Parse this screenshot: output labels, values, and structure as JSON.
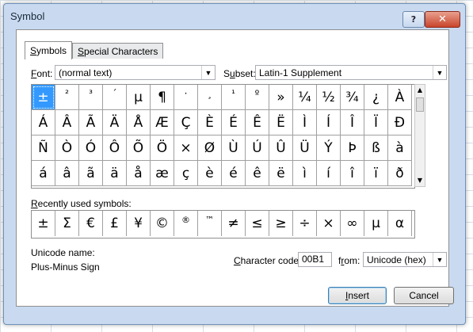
{
  "window": {
    "title": "Symbol",
    "help_label": "?",
    "close_label": "✕"
  },
  "tabs": {
    "symbols": "Symbols",
    "special": "Special Characters"
  },
  "font": {
    "label": "Font:",
    "value": "(normal text)"
  },
  "subset": {
    "label": "Subset:",
    "value": "Latin-1 Supplement"
  },
  "symbols": [
    "±",
    "²",
    "³",
    "´",
    "µ",
    "¶",
    "·",
    "¸",
    "¹",
    "º",
    "»",
    "¼",
    "½",
    "¾",
    "¿",
    "À",
    "Á",
    "Â",
    "Ã",
    "Ä",
    "Å",
    "Æ",
    "Ç",
    "È",
    "É",
    "Ê",
    "Ë",
    "Ì",
    "Í",
    "Î",
    "Ï",
    "Ð",
    "Ñ",
    "Ò",
    "Ó",
    "Ô",
    "Õ",
    "Ö",
    "×",
    "Ø",
    "Ù",
    "Ú",
    "Û",
    "Ü",
    "Ý",
    "Þ",
    "ß",
    "à",
    "á",
    "â",
    "ã",
    "ä",
    "å",
    "æ",
    "ç",
    "è",
    "é",
    "ê",
    "ë",
    "ì",
    "í",
    "î",
    "ï",
    "ð"
  ],
  "selected_index": 0,
  "recent": {
    "label": "Recently used symbols:",
    "items": [
      "±",
      "Σ",
      "€",
      "£",
      "¥",
      "©",
      "®",
      "™",
      "≠",
      "≤",
      "≥",
      "÷",
      "×",
      "∞",
      "µ",
      "α"
    ]
  },
  "unicode": {
    "label": "Unicode name:",
    "value": "Plus-Minus Sign"
  },
  "charcode": {
    "label": "Character code:",
    "value": "00B1"
  },
  "from": {
    "label": "from:",
    "value": "Unicode (hex)"
  },
  "buttons": {
    "insert": "Insert",
    "cancel": "Cancel"
  }
}
